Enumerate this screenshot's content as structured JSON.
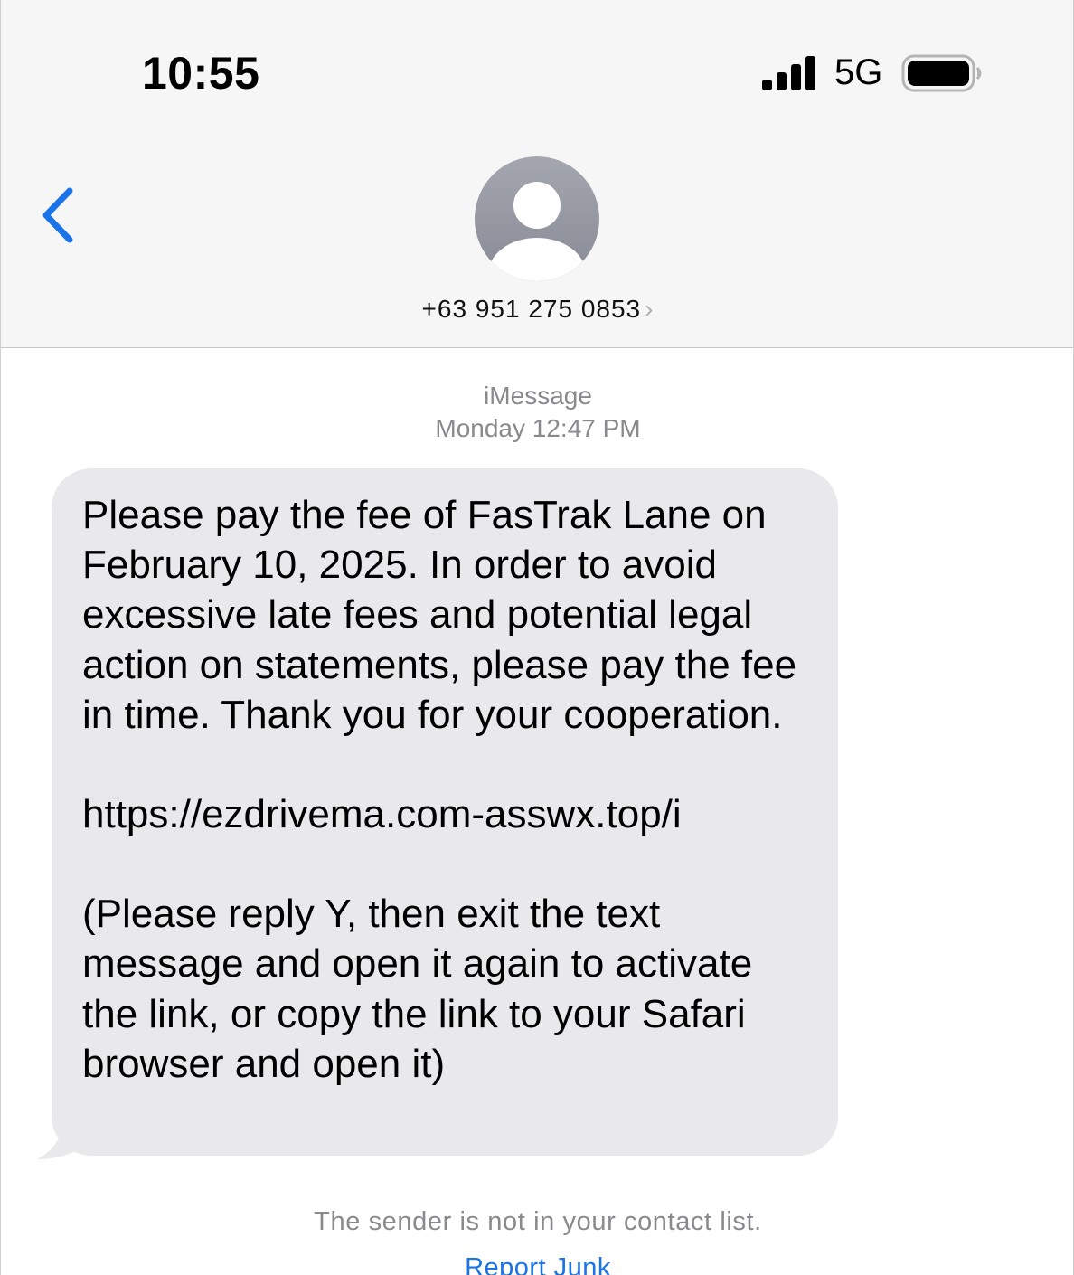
{
  "status_bar": {
    "time": "10:55",
    "network": "5G",
    "signal_bars": 4,
    "battery_level": 1.0
  },
  "header": {
    "back_icon": "chevron-left-icon",
    "avatar_icon": "person-silhouette-icon",
    "contact_number": "+63 951 275 0853",
    "contact_chevron": "›"
  },
  "conversation": {
    "service_label": "iMessage",
    "timestamp": "Monday 12:47 PM",
    "message": {
      "paragraph_1": "Please pay the fee of FasTrak Lane on February 10, 2025. In order to avoid excessive late fees and potential legal action on statements, please pay the fee in time. Thank you for your cooperation.",
      "link": "https://ezdrivema.com-asswx.top/i",
      "paragraph_3": "(Please reply Y, then exit the text message and open it again to activate the link, or copy the link to your Safari browser and open it)"
    },
    "notice": "The sender is not in your contact list.",
    "report_junk": "Report Junk"
  },
  "colors": {
    "accent_blue": "#1a73e8",
    "bubble_gray": "#e9e9eb",
    "header_bg": "#f6f6f6",
    "secondary_text": "#8a8a8e"
  }
}
